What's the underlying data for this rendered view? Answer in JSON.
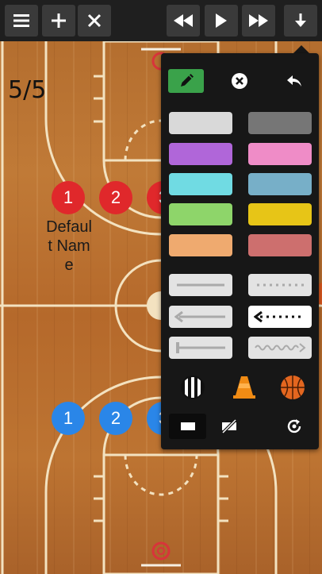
{
  "toolbar": {
    "menu": "menu-icon",
    "add": "plus-icon",
    "close": "close-icon",
    "rewind": "rewind-icon",
    "play": "play-icon",
    "forward": "fast-forward-icon",
    "down": "arrow-down-icon"
  },
  "frame_counter": "5/5",
  "players": {
    "red": [
      "1",
      "2",
      "3"
    ],
    "blue": [
      "1",
      "2",
      "3"
    ],
    "red_name": "Default Name"
  },
  "panel": {
    "colors": [
      {
        "name": "light-gray",
        "hex": "#d9d9d9"
      },
      {
        "name": "dark-gray",
        "hex": "#767676"
      },
      {
        "name": "purple",
        "hex": "#b066d9"
      },
      {
        "name": "pink",
        "hex": "#ef8cc7"
      },
      {
        "name": "cyan",
        "hex": "#70dbe3"
      },
      {
        "name": "steel-blue",
        "hex": "#77afc8"
      },
      {
        "name": "green",
        "hex": "#8ed56a"
      },
      {
        "name": "yellow",
        "hex": "#e7c517"
      },
      {
        "name": "orange",
        "hex": "#efaa6f"
      },
      {
        "name": "rose",
        "hex": "#cd6f6e"
      }
    ],
    "line_styles": [
      "solid-line",
      "dotted-line",
      "arrow-line",
      "dotted-arrow-line",
      "screen-line",
      "wavy-arrow-line"
    ],
    "objects": [
      "referee-icon",
      "cone-icon",
      "basketball-icon"
    ],
    "bottom_tools": [
      "rectangle-icon",
      "no-fill-icon",
      "reset-icon"
    ]
  },
  "colors": {
    "toolbar_bg": "#1f1f1f",
    "button_bg": "#3a3a3a",
    "panel_bg": "#171717",
    "pencil_active": "#3aa24a",
    "red_team": "#e0282b",
    "blue_team": "#2a86e8"
  }
}
